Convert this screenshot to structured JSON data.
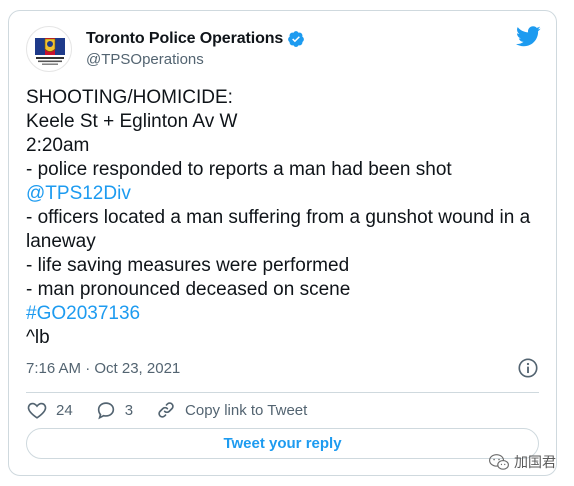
{
  "tweet": {
    "display_name": "Toronto Police Operations",
    "handle": "@TPSOperations",
    "lines": [
      "SHOOTING/HOMICIDE:",
      "Keele St + Eglinton Av W",
      "2:20am",
      "- police responded to reports a man had been shot",
      "@TPS12Div",
      "- officers located a man suffering from a gunshot wound in a laneway",
      "- life saving measures were performed",
      "- man pronounced deceased on scene",
      "#GO2037136",
      "^lb"
    ],
    "timestamp": "7:16 AM · Oct 23, 2021",
    "likes": "24",
    "replies": "3",
    "copy_link_label": "Copy link to Tweet",
    "reply_button_label": "Tweet your reply"
  },
  "watermark": {
    "text": "加国君"
  },
  "colors": {
    "link": "#1d9bf0",
    "text": "#0f1419",
    "secondary": "#536471",
    "border": "#cfd9de"
  },
  "icons": {
    "bird": "twitter-bird-icon",
    "verified": "verified-badge-icon",
    "info": "info-icon",
    "like": "heart-icon",
    "reply": "speech-bubble-icon",
    "copy": "link-icon",
    "watermark": "wechat-icon"
  }
}
